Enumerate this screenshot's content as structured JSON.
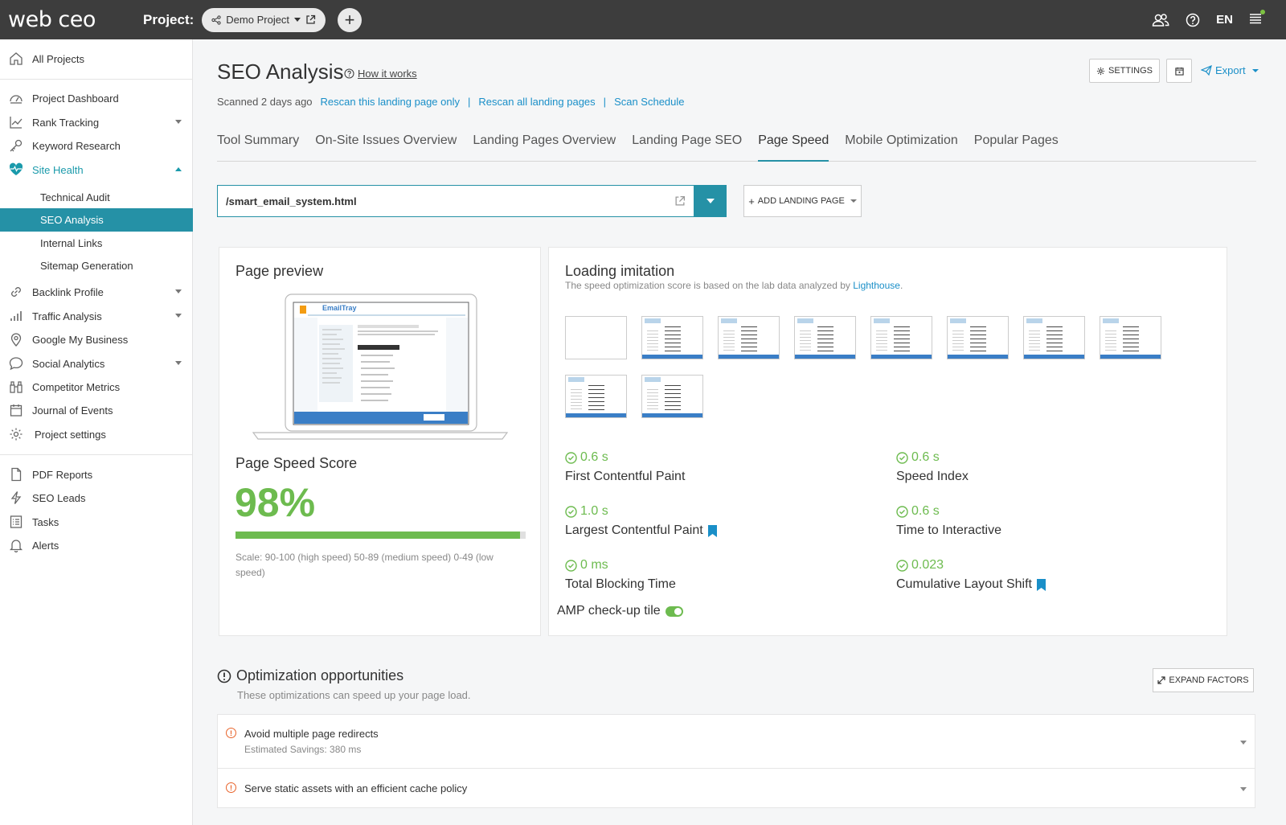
{
  "app": {
    "logo": "web ceo",
    "project_label": "Project:",
    "project_name": "Demo Project",
    "language": "EN"
  },
  "sidebar": {
    "all_projects": "All Projects",
    "items": [
      {
        "label": "Project Dashboard",
        "icon": "dashboard-icon"
      },
      {
        "label": "Rank Tracking",
        "icon": "chart-icon"
      },
      {
        "label": "Keyword Research",
        "icon": "key-icon"
      },
      {
        "label": "Site Health",
        "icon": "heart-icon"
      },
      {
        "label": "Backlink Profile",
        "icon": "link-icon"
      },
      {
        "label": "Traffic Analysis",
        "icon": "bars-icon"
      },
      {
        "label": "Google My Business",
        "icon": "pin-icon"
      },
      {
        "label": "Social Analytics",
        "icon": "chat-icon"
      },
      {
        "label": "Competitor Metrics",
        "icon": "binoculars-icon"
      },
      {
        "label": "Journal of Events",
        "icon": "calendar-icon"
      },
      {
        "label": "Project settings",
        "icon": "gear-icon"
      }
    ],
    "site_health_sub": [
      "Technical Audit",
      "SEO Analysis",
      "Internal Links",
      "Sitemap Generation"
    ],
    "bottom": [
      {
        "label": "PDF Reports",
        "icon": "pdf-icon"
      },
      {
        "label": "SEO Leads",
        "icon": "bolt-icon"
      },
      {
        "label": "Tasks",
        "icon": "tasks-icon"
      },
      {
        "label": "Alerts",
        "icon": "bell-icon"
      }
    ]
  },
  "header": {
    "title": "SEO Analysis",
    "how_it_works": "How it works",
    "scanned": "Scanned 2 days ago",
    "rescan_page": "Rescan this landing page only",
    "rescan_all": "Rescan all landing pages",
    "scan_schedule": "Scan Schedule",
    "settings": "SETTINGS",
    "export": "Export"
  },
  "tabs": [
    "Tool Summary",
    "On-Site Issues Overview",
    "Landing Pages Overview",
    "Landing Page SEO",
    "Page Speed",
    "Mobile Optimization",
    "Popular Pages"
  ],
  "url_input": {
    "value": "/smart_email_system.html"
  },
  "add_landing_page": "ADD LANDING PAGE",
  "preview": {
    "title": "Page preview",
    "thumb_brand": "EmailTray",
    "score_title": "Page Speed Score",
    "score": "98%",
    "score_value": 0.98,
    "scale": "Scale: 90-100 (high speed) 50-89 (medium speed) 0-49 (low speed)"
  },
  "loading": {
    "title": "Loading imitation",
    "subtitle": "The speed optimization score is based on the lab data analyzed by",
    "link": "Lighthouse",
    "period": ".",
    "frames": 10
  },
  "metrics": [
    {
      "value": "0.6 s",
      "name": "First Contentful Paint",
      "flag": false
    },
    {
      "value": "0.6 s",
      "name": "Speed Index",
      "flag": false
    },
    {
      "value": "1.0 s",
      "name": "Largest Contentful Paint",
      "flag": true
    },
    {
      "value": "0.6 s",
      "name": "Time to Interactive",
      "flag": false
    },
    {
      "value": "0 ms",
      "name": "Total Blocking Time",
      "flag": false
    },
    {
      "value": "0.023",
      "name": "Cumulative Layout Shift",
      "flag": true
    }
  ],
  "amp_label": "AMP check-up tile",
  "opportunities": {
    "title": "Optimization opportunities",
    "subtitle": "These optimizations can speed up your page load.",
    "expand": "EXPAND FACTORS",
    "items": [
      {
        "name": "Avoid multiple page redirects",
        "savings": "Estimated Savings: 380 ms"
      },
      {
        "name": "Serve static assets with an efficient cache policy",
        "savings": ""
      }
    ]
  },
  "colors": {
    "accent": "#2591a6",
    "good": "#6dbb4f",
    "link": "#1a8fc8",
    "warn": "#e8632a"
  }
}
